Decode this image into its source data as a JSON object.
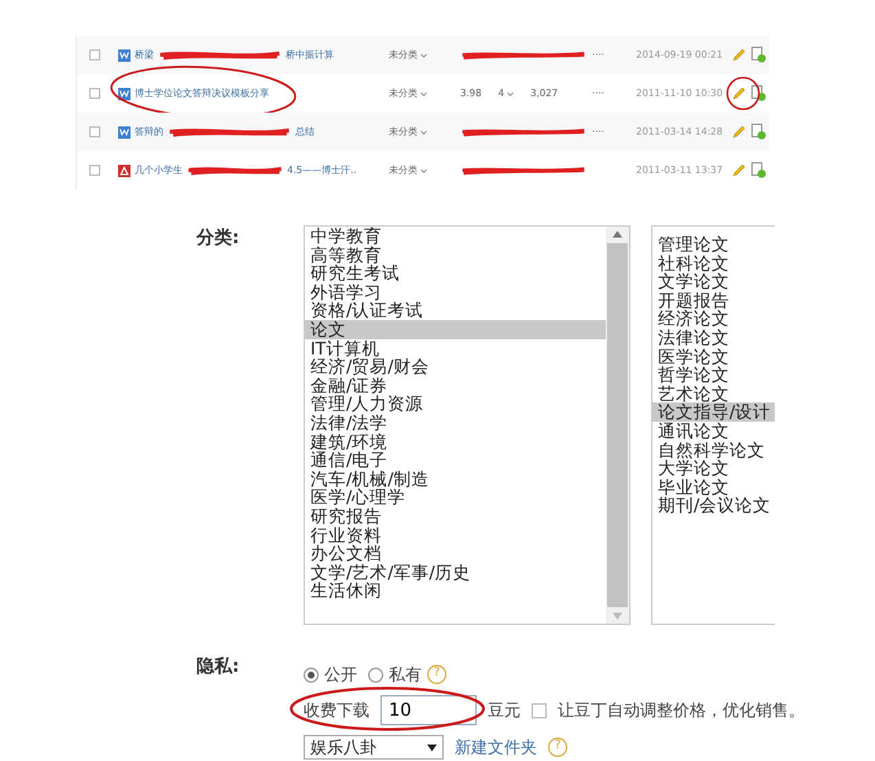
{
  "files": [
    {
      "kind": "word",
      "checked": false,
      "title_start": "桥梁",
      "title_end": "桥中振计算",
      "redacted": true,
      "category": "未分类",
      "more": "····",
      "date": "2014-09-19 00:21",
      "circled": false,
      "edit_circled": false
    },
    {
      "kind": "word",
      "checked": false,
      "title_start": "博士学位论文答辩决议模板分享",
      "redacted": false,
      "category": "未分类",
      "score": "3.98",
      "rating": "4",
      "downloads": "3,027",
      "more": "····",
      "date": "2011-11-10 10:30",
      "circled": true,
      "edit_circled": true
    },
    {
      "kind": "word",
      "checked": false,
      "title_start": "答辩的",
      "title_end": "总结",
      "redacted": true,
      "category": "未分类",
      "more": "····",
      "date": "2011-03-14 14:28",
      "circled": false,
      "edit_circled": false
    },
    {
      "kind": "pdf",
      "checked": false,
      "title_start": "几个小学生",
      "title_end": "4.5——博士汗..",
      "redacted": true,
      "category": "未分类",
      "date": "2011-03-11 13:37",
      "circled": false,
      "edit_circled": false
    }
  ],
  "category_label": "分类:",
  "categories": [
    {
      "label": "中学教育",
      "selected": false
    },
    {
      "label": "高等教育",
      "selected": false
    },
    {
      "label": "研究生考试",
      "selected": false
    },
    {
      "label": "外语学习",
      "selected": false
    },
    {
      "label": "资格/认证考试",
      "selected": false
    },
    {
      "label": "论文",
      "selected": true
    },
    {
      "label": "IT计算机",
      "selected": false
    },
    {
      "label": "经济/贸易/财会",
      "selected": false
    },
    {
      "label": "金融/证券",
      "selected": false
    },
    {
      "label": "管理/人力资源",
      "selected": false
    },
    {
      "label": "法律/法学",
      "selected": false
    },
    {
      "label": "建筑/环境",
      "selected": false
    },
    {
      "label": "通信/电子",
      "selected": false
    },
    {
      "label": "汽车/机械/制造",
      "selected": false
    },
    {
      "label": "医学/心理学",
      "selected": false
    },
    {
      "label": "研究报告",
      "selected": false
    },
    {
      "label": "行业资料",
      "selected": false
    },
    {
      "label": "办公文档",
      "selected": false
    },
    {
      "label": "文学/艺术/军事/历史",
      "selected": false
    },
    {
      "label": "生活休闲",
      "selected": false
    }
  ],
  "subcategories": [
    {
      "label": "管理论文",
      "selected": false
    },
    {
      "label": "社科论文",
      "selected": false
    },
    {
      "label": "文学论文",
      "selected": false
    },
    {
      "label": "开题报告",
      "selected": false
    },
    {
      "label": "经济论文",
      "selected": false
    },
    {
      "label": "法律论文",
      "selected": false
    },
    {
      "label": "医学论文",
      "selected": false
    },
    {
      "label": "哲学论文",
      "selected": false
    },
    {
      "label": "艺术论文",
      "selected": false
    },
    {
      "label": "论文指导/设计",
      "selected": true
    },
    {
      "label": "通讯论文",
      "selected": false
    },
    {
      "label": "自然科学论文",
      "selected": false
    },
    {
      "label": "大学论文",
      "selected": false
    },
    {
      "label": "毕业论文",
      "selected": false
    },
    {
      "label": "期刊/会议论文",
      "selected": false
    }
  ],
  "privacy_label": "隐私:",
  "privacy_options": [
    {
      "label": "公开",
      "selected": true
    },
    {
      "label": "私有",
      "selected": false,
      "help": "?"
    }
  ],
  "fee": {
    "label": "收费下载",
    "value": "10",
    "unit": "豆元",
    "auto_checked": false,
    "auto_label": "让豆丁自动调整价格，优化销售。",
    "circled": true
  },
  "folder": {
    "value": "娱乐八卦",
    "new_link": "新建文件夹",
    "help": "?"
  }
}
